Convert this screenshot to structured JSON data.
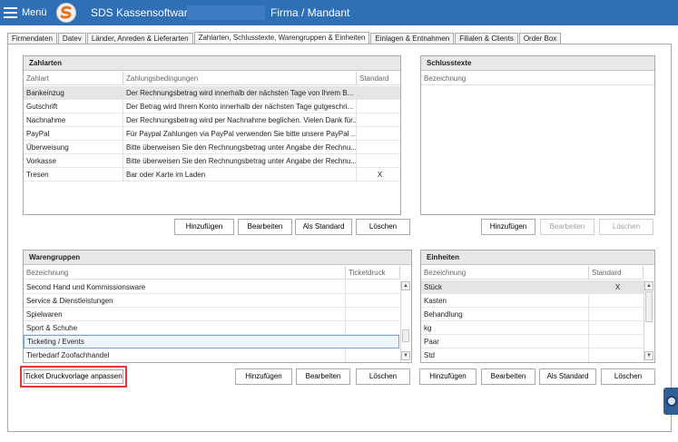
{
  "titlebar": {
    "menu_label": "Menü",
    "app_title": "SDS Kassensoftware",
    "firma_title": "Firma / Mandant"
  },
  "tabs": [
    {
      "label": "Firmendaten"
    },
    {
      "label": "Datev"
    },
    {
      "label": "Länder, Anreden & Lieferarten"
    },
    {
      "label": "Zahlarten, Schlusstexte, Warengruppen & Einheiten",
      "active": true
    },
    {
      "label": "Einlagen & Entnahmen"
    },
    {
      "label": "Filialen & Clients"
    },
    {
      "label": "Order Box"
    }
  ],
  "zahlarten": {
    "title": "Zahlarten",
    "columns": [
      "Zahlart",
      "Zahlungsbedingungen",
      "Standard"
    ],
    "rows": [
      {
        "name": "Bankeinzug",
        "text": "Der Rechnungsbetrag wird innerhalb der nächsten Tage von Ihrem B...",
        "std": ""
      },
      {
        "name": "Gutschrift",
        "text": "Der Betrag wird Ihrem Konto innerhalb der nächsten Tage gutgeschri...",
        "std": ""
      },
      {
        "name": "Nachnahme",
        "text": "Der Rechnungsbetrag wird per Nachnahme beglichen. Vielen Dank für...",
        "std": ""
      },
      {
        "name": "PayPal",
        "text": "Für Paypal Zahlungen via PayPal verwenden Sie bitte unsere PayPal ...",
        "std": ""
      },
      {
        "name": "Überweisung",
        "text": "Bitte überweisen Sie den Rechnungsbetrag unter Angabe der Rechnu...",
        "std": ""
      },
      {
        "name": "Vorkasse",
        "text": "Bitte überweisen Sie den Rechnungsbetrag unter Angabe der Rechnu...",
        "std": ""
      },
      {
        "name": "Tresen",
        "text": "Bar oder Karte im Laden",
        "std": "X"
      }
    ],
    "buttons": {
      "add": "Hinzufügen",
      "edit": "Bearbeiten",
      "default": "Als Standard",
      "delete": "Löschen"
    }
  },
  "schlusstexte": {
    "title": "Schlusstexte",
    "columns": [
      "Bezeichnung"
    ],
    "buttons": {
      "add": "Hinzufügen",
      "edit": "Bearbeiten",
      "delete": "Löschen"
    }
  },
  "warengruppen": {
    "title": "Warengruppen",
    "columns": [
      "Bezeichnung",
      "Ticketdruck"
    ],
    "rows": [
      {
        "name": "Second Hand und Kommissionsware"
      },
      {
        "name": "Service & Dienstleistungen"
      },
      {
        "name": "Spielwaren"
      },
      {
        "name": "Sport & Schuhe"
      },
      {
        "name": "Ticketing / Events"
      },
      {
        "name": "Tierbedarf Zoofachhandel"
      }
    ],
    "ticket_button": "Ticket Druckvorlage anpassen",
    "buttons": {
      "add": "Hinzufügen",
      "edit": "Bearbeiten",
      "delete": "Löschen"
    }
  },
  "einheiten": {
    "title": "Einheiten",
    "columns": [
      "Bezeichnung",
      "Standard"
    ],
    "rows": [
      {
        "name": "Stück",
        "std": "X"
      },
      {
        "name": "Kasten",
        "std": ""
      },
      {
        "name": "Behandlung",
        "std": ""
      },
      {
        "name": "kg",
        "std": ""
      },
      {
        "name": "Paar",
        "std": ""
      },
      {
        "name": "Std",
        "std": ""
      }
    ],
    "buttons": {
      "add": "Hinzufügen",
      "edit": "Bearbeiten",
      "default": "Als Standard",
      "delete": "Löschen"
    }
  },
  "colors": {
    "titlebar": "#2f6fb6",
    "highlight_border": "#e03c32",
    "selected_row": "#e5e5e5"
  },
  "icons": {
    "menu": "hamburger-icon",
    "logo": "sds-logo-icon",
    "scroll_up": "scroll-up-arrow-icon",
    "scroll_down": "scroll-down-arrow-icon",
    "side_tab": "support-lifebuoy-icon"
  }
}
